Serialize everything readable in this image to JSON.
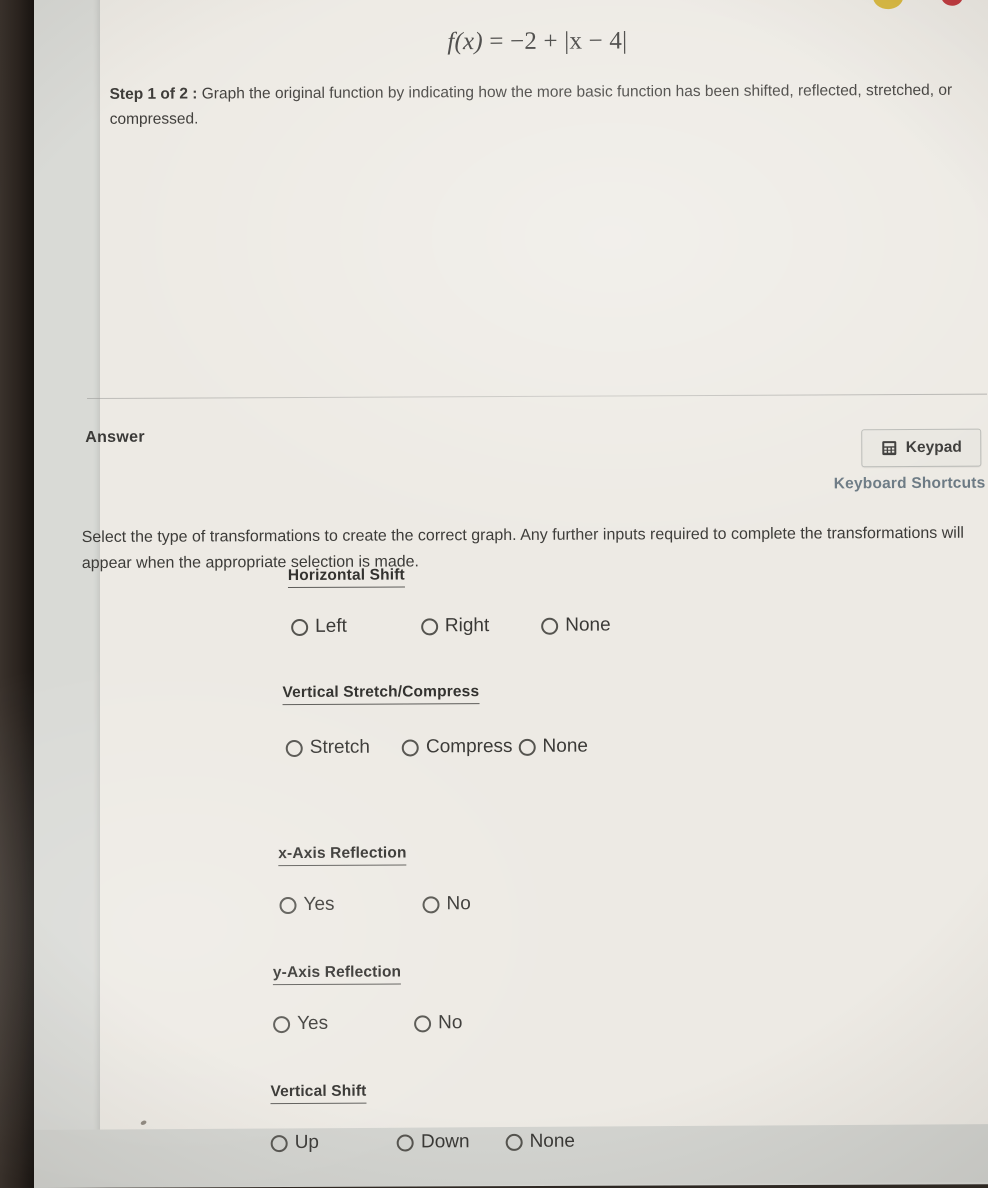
{
  "question": {
    "formula_plain": "f(x) = -2 + |x - 4|",
    "formula_fx": "f",
    "formula_arg": "(x)",
    "formula_rest": " = −2 + |x − 4|",
    "step_label": "Step 1 of 2 :",
    "step_text": " Graph the original function by indicating how the more basic function has been shifted, reflected, stretched, or compressed."
  },
  "answer_section": {
    "title": "Answer",
    "keypad_button_label": "Keypad",
    "keypad_icon": "calculator-keypad-icon",
    "keyboard_shortcuts_label": "Keyboard Shortcuts",
    "instructions": "Select the type of transformations to create the correct graph. Any further inputs required to complete the transformations will appear when the appropriate selection is made."
  },
  "transformation_groups": [
    {
      "title": "Horizontal Shift",
      "options": [
        {
          "label": "Left",
          "selected": false
        },
        {
          "label": "Right",
          "selected": false
        },
        {
          "label": "None",
          "selected": false
        }
      ]
    },
    {
      "title": "Vertical Stretch/Compress",
      "options": [
        {
          "label": "Stretch",
          "selected": false
        },
        {
          "label": "Compress",
          "selected": false
        },
        {
          "label": "None",
          "selected": false
        }
      ]
    },
    {
      "title": "x-Axis Reflection",
      "options": [
        {
          "label": "Yes",
          "selected": false
        },
        {
          "label": "No",
          "selected": false
        }
      ]
    },
    {
      "title": "y-Axis Reflection",
      "options": [
        {
          "label": "Yes",
          "selected": false
        },
        {
          "label": "No",
          "selected": false
        }
      ]
    },
    {
      "title": "Vertical Shift",
      "options": [
        {
          "label": "Up",
          "selected": false
        },
        {
          "label": "Down",
          "selected": false
        },
        {
          "label": "None",
          "selected": false
        }
      ]
    }
  ],
  "colors": {
    "page_background": "#edeae4",
    "text": "#3c3b38",
    "link": "#6c7a84",
    "bezel": "#2a231e",
    "accent_yellow": "#d7b73e",
    "accent_red": "#c03a3f"
  }
}
